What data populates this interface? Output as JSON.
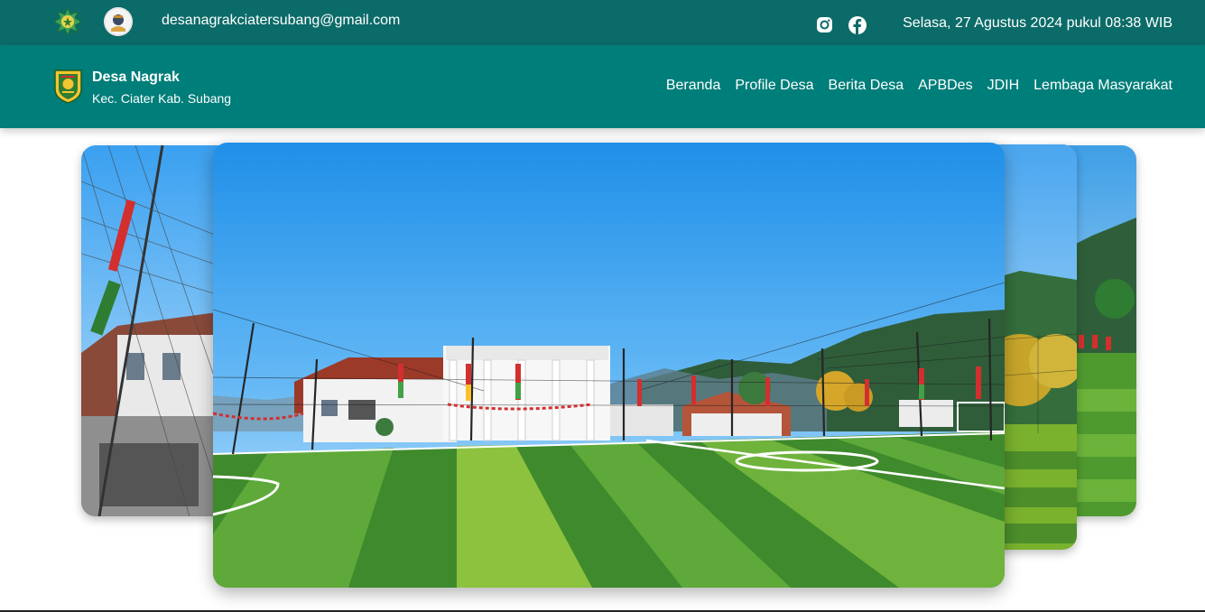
{
  "topbar": {
    "email": "desanagrakciatersubang@gmail.com",
    "datetime": "Selasa, 27 Agustus 2024 pukul 08:38 WIB",
    "social": [
      "instagram-icon",
      "facebook-icon"
    ]
  },
  "header": {
    "title": "Desa Nagrak",
    "subtitle": "Kec. Ciater Kab. Subang"
  },
  "nav": {
    "items": [
      {
        "label": "Beranda"
      },
      {
        "label": "Profile Desa"
      },
      {
        "label": "Berita Desa"
      },
      {
        "label": "APBDes"
      },
      {
        "label": "JDIH"
      },
      {
        "label": "Lembaga Masyarakat"
      }
    ]
  },
  "carousel": {
    "active_index": 1,
    "slides": [
      "village-building-fence",
      "mini-soccer-field",
      "field-with-trees",
      "field-with-people"
    ]
  },
  "colors": {
    "topbar": "#0b6b68",
    "navbar": "#007e7a"
  }
}
